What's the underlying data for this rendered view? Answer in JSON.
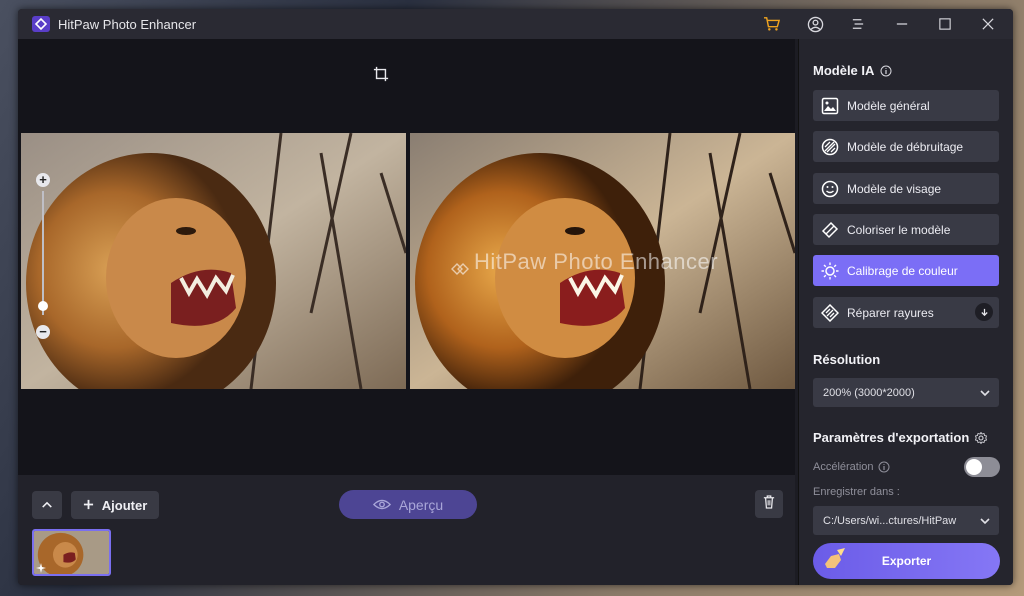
{
  "app": {
    "title": "HitPaw Photo Enhancer"
  },
  "watermark": "HitPaw Photo Enhancer",
  "bottom": {
    "add_label": "Ajouter",
    "preview_label": "Aperçu"
  },
  "panel": {
    "model_title": "Modèle IA",
    "models": [
      {
        "label": "Modèle général",
        "icon": "image-icon"
      },
      {
        "label": "Modèle de débruitage",
        "icon": "denoise-icon"
      },
      {
        "label": "Modèle de visage",
        "icon": "face-icon"
      },
      {
        "label": "Coloriser le modèle",
        "icon": "colorize-icon"
      },
      {
        "label": "Calibrage de couleur",
        "icon": "sun-icon",
        "active": true
      },
      {
        "label": "Réparer rayures",
        "icon": "repair-icon"
      }
    ],
    "resolution_title": "Résolution",
    "resolution_value": "200% (3000*2000)",
    "export_settings_title": "Paramètres d'exportation",
    "acceleration_label": "Accélération",
    "acceleration_on": false,
    "save_in_label": "Enregistrer dans :",
    "save_path": "C:/Users/wi...ctures/HitPaw",
    "export_label": "Exporter"
  },
  "colors": {
    "accent": "#7b6ef6",
    "panel": "#25252d",
    "button": "#393a45"
  }
}
